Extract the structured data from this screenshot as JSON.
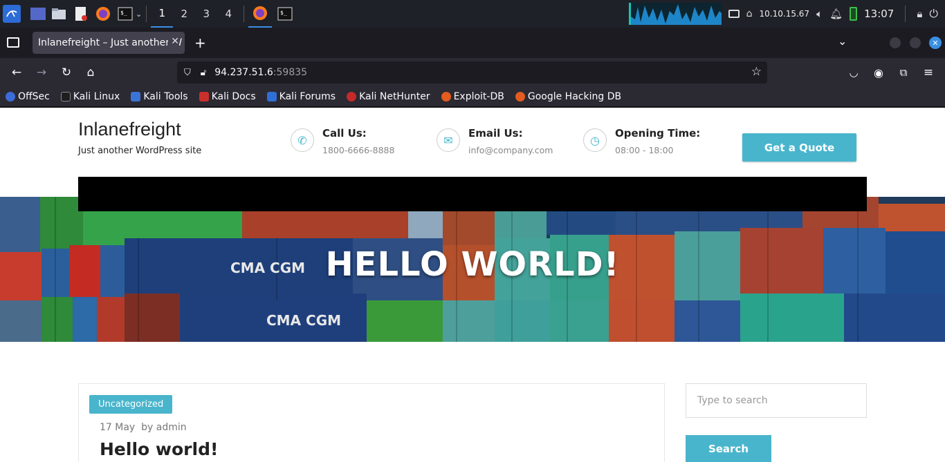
{
  "taskbar": {
    "workspaces": [
      "1",
      "2",
      "3",
      "4"
    ],
    "ip": "10.10.15.67",
    "clock": "13:07"
  },
  "browser": {
    "tab_title": "Inlanefreight – Just another W",
    "url_host": "94.237.51.6",
    "url_port": ":59835",
    "bookmarks": [
      "OffSec",
      "Kali Linux",
      "Kali Tools",
      "Kali Docs",
      "Kali Forums",
      "Kali NetHunter",
      "Exploit-DB",
      "Google Hacking DB"
    ]
  },
  "site": {
    "title": "Inlanefreight",
    "tagline": "Just another WordPress site",
    "call_label": "Call Us:",
    "call_value": "1800-6666-8888",
    "email_label": "Email Us:",
    "email_value": "info@company.com",
    "hours_label": "Opening Time:",
    "hours_value": "08:00 - 18:00",
    "quote_button": "Get a Quote",
    "hero_title": "HELLO WORLD!",
    "hero_container_text": [
      "CMA CGM",
      "CMA CGM"
    ]
  },
  "post": {
    "category": "Uncategorized",
    "date": "17 May",
    "author_prefix": "by",
    "author": "admin",
    "title": "Hello world!"
  },
  "sidebar": {
    "search_placeholder": "Type to search",
    "search_button": "Search"
  },
  "colors": {
    "accent": "#49b5cc",
    "browser_dark": "#2b2a33",
    "taskbar": "#1f2128"
  }
}
